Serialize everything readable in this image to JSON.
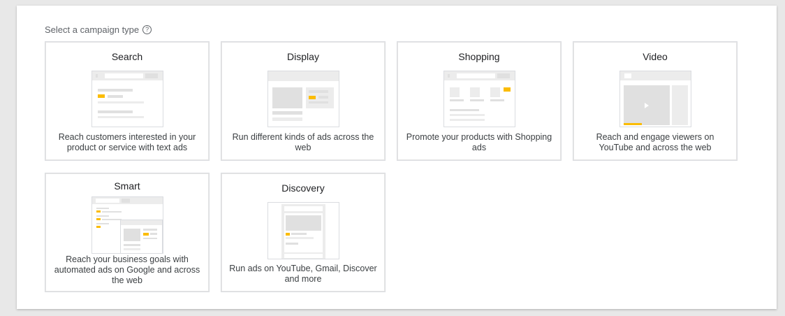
{
  "heading": {
    "label": "Select a campaign type",
    "help_icon": "?"
  },
  "cards": [
    {
      "title": "Search",
      "description": "Reach customers interested in your product or service with text ads"
    },
    {
      "title": "Display",
      "description": "Run different kinds of ads across the web"
    },
    {
      "title": "Shopping",
      "description": "Promote your products with Shopping ads"
    },
    {
      "title": "Video",
      "description": "Reach and engage viewers on YouTube and across the web"
    },
    {
      "title": "Smart",
      "description": "Reach your business goals with automated ads on Google and across the web"
    },
    {
      "title": "Discovery",
      "description": "Run ads on YouTube, Gmail, Discover and more"
    }
  ],
  "colors": {
    "accent": "#fbbc04",
    "border": "#dadce0",
    "placeholder": "#e0e0e0"
  }
}
